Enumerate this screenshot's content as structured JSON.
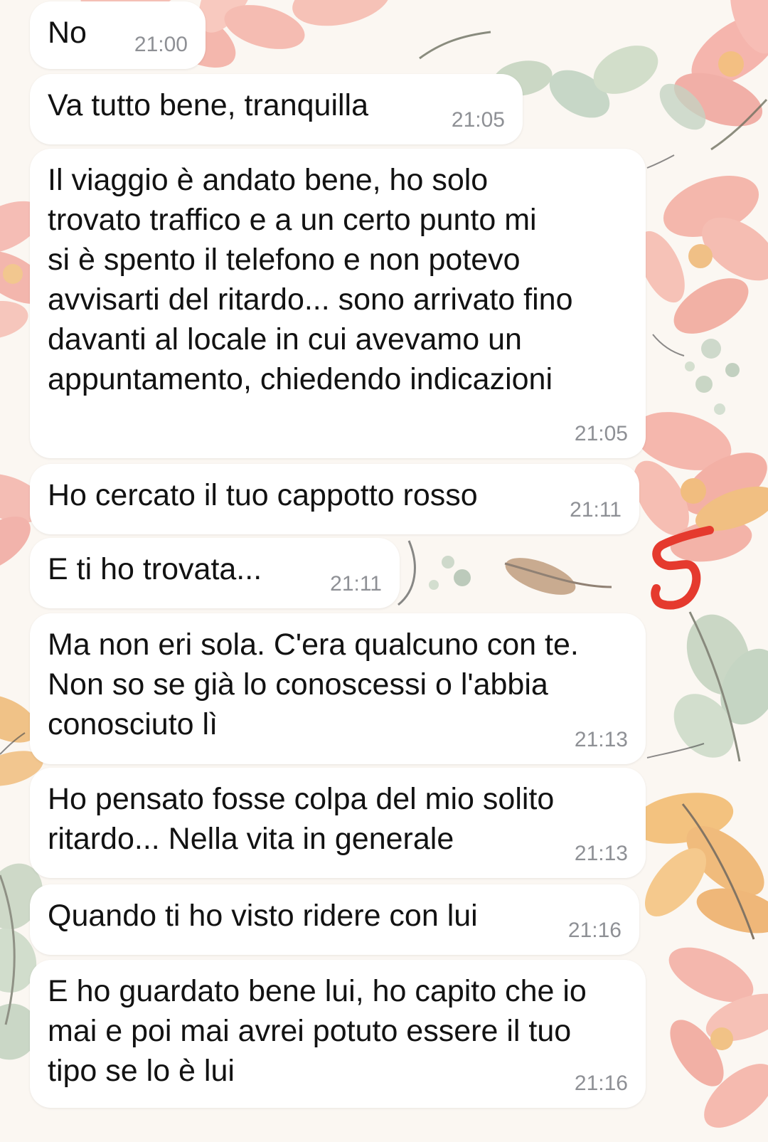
{
  "chat": {
    "messages": [
      {
        "text": "No",
        "time": "21:00"
      },
      {
        "text": "Va tutto bene, tranquilla",
        "time": "21:05"
      },
      {
        "text": "Il viaggio è andato bene, ho solo\ntrovato traffico e a un certo punto mi\nsi è spento il telefono e non potevo\navvisarti del ritardo... sono arrivato fino\ndavanti al locale in cui avevamo un\nappuntamento, chiedendo indicazioni",
        "time": "21:05"
      },
      {
        "text": "Ho cercato il tuo cappotto rosso",
        "time": "21:11"
      },
      {
        "text": "E ti ho trovata...",
        "time": "21:11"
      },
      {
        "text": "Ma non eri sola. C'era qualcuno con te.\nNon so se già lo conoscessi o l'abbia\nconosciuto lì",
        "time": "21:13"
      },
      {
        "text": "Ho pensato fosse colpa del mio solito\nritardo... Nella vita in generale",
        "time": "21:13"
      },
      {
        "text": "Quando ti ho visto ridere con lui",
        "time": "21:16"
      },
      {
        "text": "E ho guardato bene lui, ho capito che io\nmai e poi mai avrei potuto essere il tuo\ntipo se lo è lui",
        "time": "21:16"
      }
    ]
  },
  "annotation": {
    "text": "5",
    "color": "#e53a2e"
  },
  "colors": {
    "bubble": "#ffffff",
    "message_text": "#121212",
    "time_text": "#8e9095",
    "wallpaper_pink": "#f3b1a5",
    "wallpaper_green": "#b5c9b5",
    "wallpaper_orange": "#f1b06f"
  },
  "icons": {
    "wallpaper": "floral-wallpaper-pattern",
    "annotation": "handwritten-number-five"
  }
}
